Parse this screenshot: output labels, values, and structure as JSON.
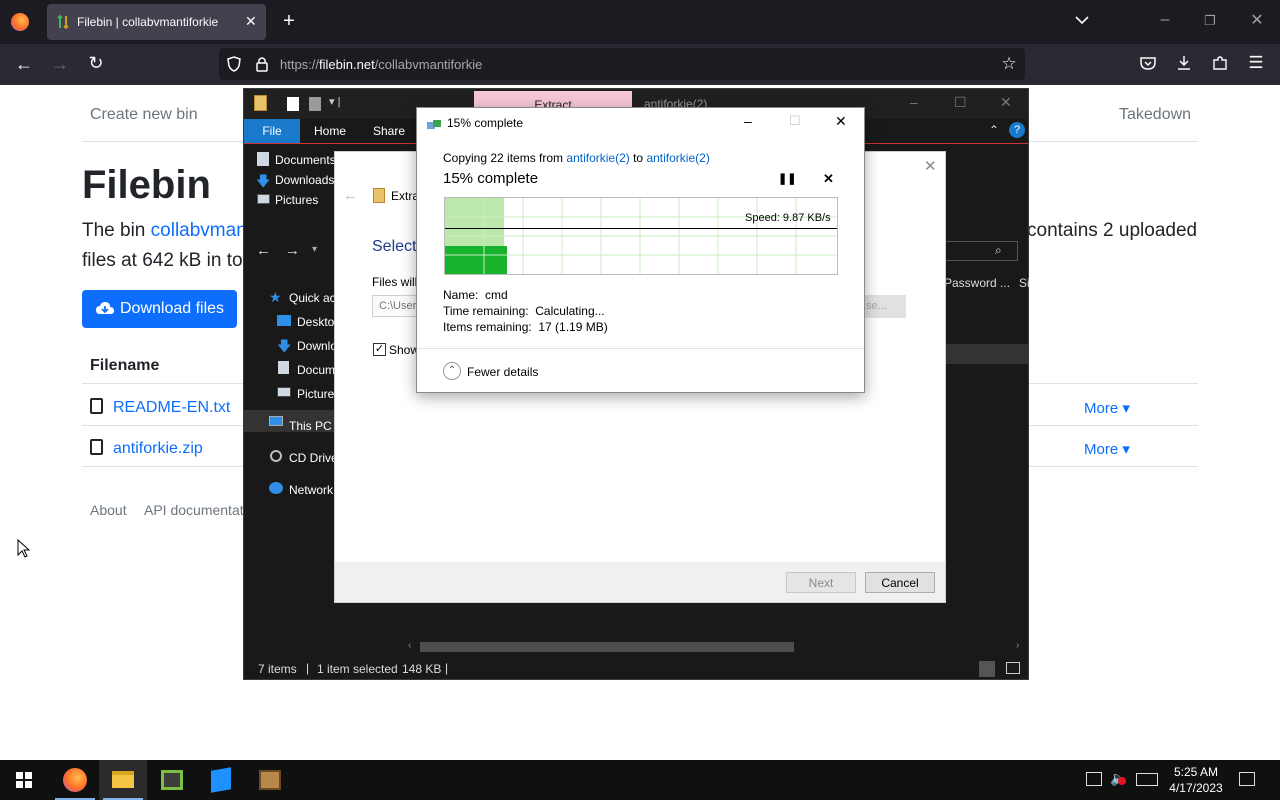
{
  "browser": {
    "tab_title": "Filebin | collabvmantiforkie",
    "url_domain": "filebin.net",
    "url_prefix": "https://",
    "url_path": "/collabvmantiforkie"
  },
  "page": {
    "nav_create": "Create new bin",
    "nav_takedown": "Takedown",
    "title": "Filebin",
    "lead_part1": "The bin ",
    "lead_bin_link": "collabvmantiforkie",
    "lead_part2": "contains 2 uploaded",
    "lead_line2": "files at 642 kB in total",
    "download_button": "Download files",
    "table_header": "Filename",
    "files": [
      {
        "name": "README-EN.txt",
        "more": "More"
      },
      {
        "name": "antiforkie.zip",
        "more": "More"
      }
    ],
    "footer_about": "About",
    "footer_api": "API documentation"
  },
  "explorer": {
    "extract_tab": "Extract",
    "title": "antiforkie(2)",
    "ribbon_tabs": [
      "File",
      "Home",
      "Share"
    ],
    "quick_items": [
      "Documents",
      "Downloads",
      "Pictures"
    ],
    "nav_items": [
      "Quick access",
      "Desktop",
      "Downloads",
      "Documents",
      "Pictures",
      "This PC",
      "CD Drive",
      "Network"
    ],
    "col_password": "Password ...",
    "col_size": "Si",
    "status_items": "7 items",
    "status_selected": "1 item selected",
    "status_size": "148 KB"
  },
  "wizard": {
    "folder_label": "Extra",
    "heading": "Select",
    "files_will": "Files will",
    "path_value": "C:\\User",
    "browse_label": "se...",
    "show_label": "Show",
    "next_button": "Next",
    "cancel_button": "Cancel"
  },
  "copy_dialog": {
    "title": "15% complete",
    "copying_prefix": "Copying 22 items from",
    "source": "antiforkie(2)",
    "to_word": "to",
    "destination": "antiforkie(2)",
    "heading": "15% complete",
    "speed": "Speed: 9.87 KB/s",
    "progress_percent": 15,
    "name_label": "Name:",
    "name_value": "cmd",
    "time_label": "Time remaining:",
    "time_value": "Calculating...",
    "items_label": "Items remaining:",
    "items_value": "17 (1.19 MB)",
    "fewer_details": "Fewer details"
  },
  "taskbar": {
    "time": "5:25 AM",
    "date": "4/17/2023"
  }
}
